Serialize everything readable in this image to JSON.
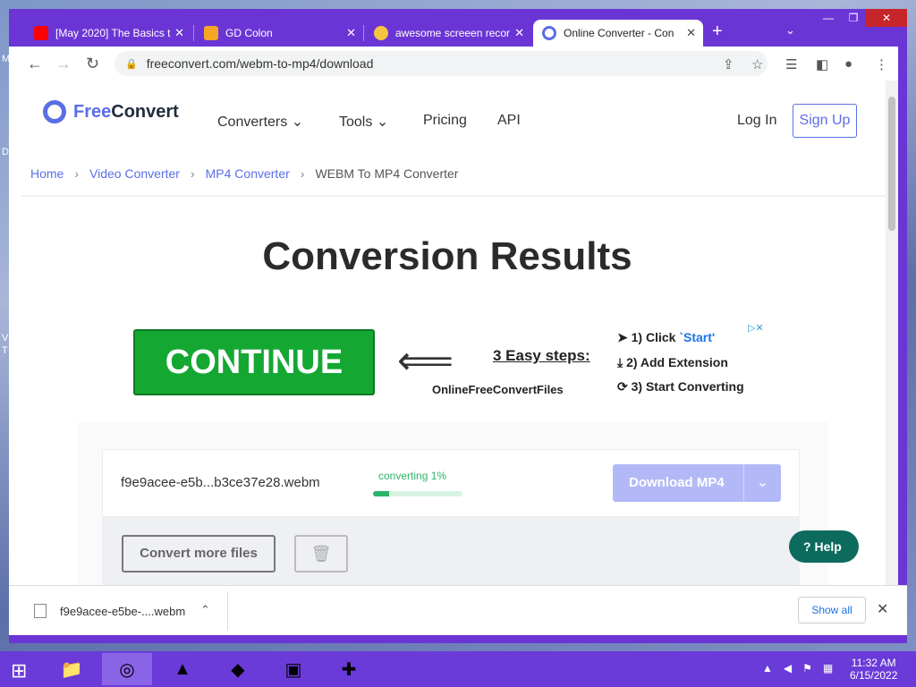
{
  "desktop": {
    "labels": [
      "M",
      "D",
      "V",
      "T"
    ]
  },
  "tabs": [
    {
      "title": "[May 2020] The Basics t",
      "favicon": "youtube-icon",
      "color": "#ff0000"
    },
    {
      "title": "GD Colon",
      "favicon": "guitar-icon",
      "color": "#f5a623"
    },
    {
      "title": "awesome screeen recor",
      "favicon": "face-icon",
      "color": "#f5c542"
    },
    {
      "title": "Online Converter - Con",
      "favicon": "freeconvert-icon",
      "color": "#5a6ee6",
      "active": true
    }
  ],
  "browser": {
    "url": "freeconvert.com/webm-to-mp4/download"
  },
  "site": {
    "logo_free": "Free",
    "logo_convert": "Convert",
    "nav": {
      "converters": "Converters",
      "tools": "Tools",
      "pricing": "Pricing",
      "api": "API"
    },
    "login": "Log In",
    "signup": "Sign Up",
    "breadcrumb": [
      "Home",
      "Video Converter",
      "MP4 Converter",
      "WEBM To MP4 Converter"
    ],
    "title": "Conversion Results"
  },
  "ad": {
    "continue": "CONTINUE",
    "steps_title": "3 Easy steps:",
    "brand": "OnlineFreeConvertFiles",
    "step1_prefix": "1) Click ",
    "step1_highlight": "`Start'",
    "step2": "2) Add Extension",
    "step3": "3) Start Converting"
  },
  "conversion": {
    "file_name": "f9e9acee-e5b...b3ce37e28.webm",
    "status": "converting 1%",
    "progress": 0.01,
    "download_label": "Download MP4",
    "convert_more": "Convert more files"
  },
  "help": {
    "label": "Help"
  },
  "download_bar": {
    "file_name": "f9e9acee-e5be-....webm",
    "show_all": "Show all"
  },
  "taskbar": {
    "time": "11:32 AM",
    "date": "6/15/2022"
  }
}
